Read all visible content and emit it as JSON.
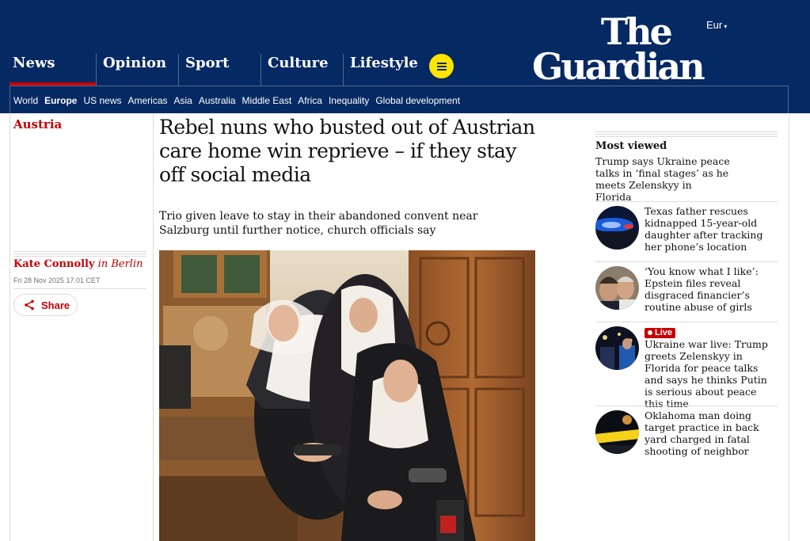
{
  "header": {
    "edition": "Eur",
    "logo_line1": "The",
    "logo_line2": "Guardian",
    "pillars": [
      "News",
      "Opinion",
      "Sport",
      "Culture",
      "Lifestyle"
    ],
    "subnav": [
      "World",
      "Europe",
      "US news",
      "Americas",
      "Asia",
      "Australia",
      "Middle East",
      "Africa",
      "Inequality",
      "Global development"
    ],
    "active_pillar": "News",
    "active_subnav": "Europe"
  },
  "article": {
    "section": "Austria",
    "headline": "Rebel nuns who busted out of Austrian care home win reprieve – if they stay off social media",
    "standfirst": "Trio given leave to stay in their abandoned convent near Salzburg until further notice, church officials say",
    "author": "Kate Connolly",
    "author_location": "in Berlin",
    "date": "Fri 28 Nov 2025 17.01 CET",
    "share_label": "Share"
  },
  "most_viewed": {
    "title": "Most viewed",
    "items": [
      {
        "text": "Trump says Ukraine peace talks in ‘final stages’ as he meets Zelenskyy in Florida",
        "icon": "none"
      },
      {
        "text": "Texas father rescues kidnapped 15-year-old daughter after tracking her phone’s location",
        "icon": "police-lights-thumbnail"
      },
      {
        "text": "‘You know what I like’: Epstein files reveal disgraced financier’s routine abuse of girls",
        "icon": "portrait-thumbnail"
      },
      {
        "text": "Ukraine war live: Trump greets Zelenskyy in Florida for peace talks and says he thinks Putin is serious about peace this time",
        "icon": "night-scene-thumbnail",
        "live_label": "Live"
      },
      {
        "text": "Oklahoma man doing target practice in back yard charged in fatal shooting of neighbor",
        "icon": "police-tape-thumbnail"
      }
    ]
  },
  "colors": {
    "brand_navy": "#052962",
    "news_red": "#c70000",
    "menu_yellow": "#ffe500"
  }
}
